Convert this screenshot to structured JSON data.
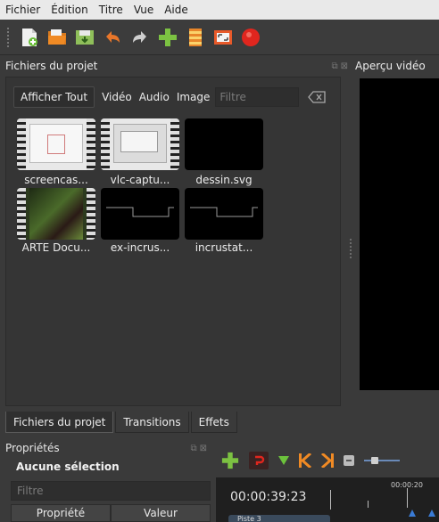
{
  "menu": {
    "file": "Fichier",
    "edit": "Édition",
    "title": "Titre",
    "view": "Vue",
    "help": "Aide"
  },
  "toolbar": {
    "icons": [
      "new-project-icon",
      "open-project-icon",
      "save-project-icon",
      "undo-icon",
      "redo-icon",
      "import-files-icon",
      "profile-icon",
      "fullscreen-icon",
      "record-icon"
    ]
  },
  "project_panel": {
    "title": "Fichiers du projet",
    "show_all": "Afficher Tout",
    "video": "Vidéo",
    "audio": "Audio",
    "image": "Image",
    "filter_placeholder": "Filtre",
    "files": [
      {
        "label": "screencas...",
        "kind": "video"
      },
      {
        "label": "vlc-captu...",
        "kind": "video"
      },
      {
        "label": "dessin.svg",
        "kind": "image"
      },
      {
        "label": "ARTE Docu...",
        "kind": "video"
      },
      {
        "label": "ex-incrus...",
        "kind": "image"
      },
      {
        "label": "incrustat...",
        "kind": "image"
      }
    ]
  },
  "preview": {
    "title": "Aperçu vidéo"
  },
  "tabs": {
    "project_files": "Fichiers du projet",
    "transitions": "Transitions",
    "effects": "Effets"
  },
  "properties": {
    "title": "Propriétés",
    "selection": "Aucune sélection",
    "filter_placeholder": "Filtre",
    "col_property": "Propriété",
    "col_value": "Valeur"
  },
  "timeline": {
    "current_time": "00:00:39:23",
    "ruler_label": "00:00:20",
    "track_name": "Piste 3"
  },
  "colors": {
    "accent_blue": "#3a7bd5",
    "record_red": "#e0261e",
    "add_green": "#7cc242"
  }
}
